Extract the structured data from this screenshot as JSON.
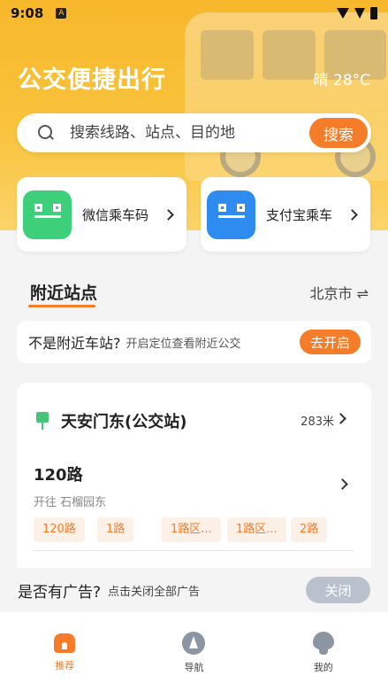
{
  "status_bar": {
    "time": "9:08",
    "badge": "A"
  },
  "header": {
    "title": "公交便捷出行",
    "weather": "晴  28°C"
  },
  "search": {
    "placeholder": "搜索线路、站点、目的地",
    "button_label": "搜索"
  },
  "pay_cards": [
    {
      "label": "微信乘车码",
      "color": "#3ecf7a"
    },
    {
      "label": "支付宝乘车",
      "color": "#2e8cf0"
    }
  ],
  "nearby": {
    "tab_label": "附近站点",
    "city": "北京市 ⇌",
    "location_prompt": {
      "question": "不是附近车站?",
      "hint": "开启定位查看附近公交",
      "button_label": "去开启"
    }
  },
  "station": {
    "name": "天安门东(公交站)",
    "distance": "283米",
    "route": {
      "name": "120路",
      "direction": "开往  石榴园东",
      "chips": [
        "120路",
        "1路",
        "1路区...",
        "1路区...",
        "2路"
      ]
    }
  },
  "ad_bar": {
    "question": "是否有广告?",
    "hint": "点击关闭全部广告",
    "close_label": "关闭"
  },
  "bottom_nav": [
    {
      "label": "推荐",
      "icon": "home-icon"
    },
    {
      "label": "导航",
      "icon": "navigation-icon"
    },
    {
      "label": "我的",
      "icon": "profile-icon"
    }
  ],
  "colors": {
    "accent": "#f57d2a",
    "header_yellow": "#f9c33c",
    "stop_green": "#47c47a"
  }
}
